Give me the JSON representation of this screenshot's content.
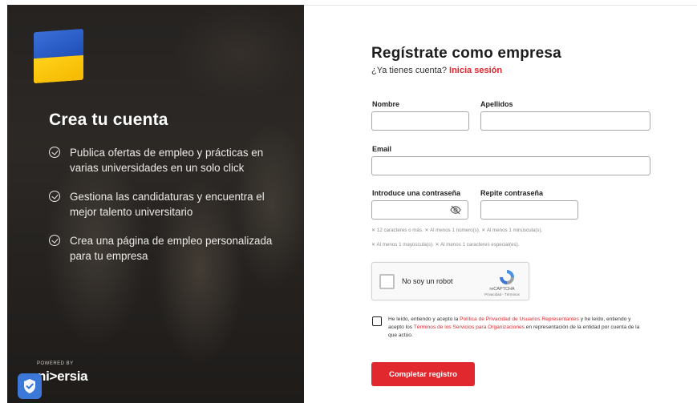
{
  "hero": {
    "title": "Crea tu cuenta",
    "benefits": [
      "Publica ofertas de empleo y prácticas en varias universidades en un solo click",
      "Gestiona las candidaturas y encuentra el mejor talento universitario",
      "Crea una página de empleo personalizada para tu empresa"
    ],
    "powered_by": "POWERED BY",
    "brand": "ni>ersia",
    "flag_colors": {
      "blue": "#2a5cc8",
      "yellow": "#ffd21a"
    }
  },
  "form": {
    "title": "Regístrate como empresa",
    "login_prompt": "¿Ya tienes cuenta?",
    "login_link": "Inicia sesión",
    "fields": {
      "first_name": {
        "label": "Nombre",
        "value": ""
      },
      "last_name": {
        "label": "Apellidos",
        "value": ""
      },
      "email": {
        "label": "Email",
        "value": ""
      },
      "password": {
        "label": "Introduce una contraseña",
        "value": ""
      },
      "password_repeat": {
        "label": "Repite contraseña",
        "value": ""
      }
    },
    "password_rules_line1": "✕ 12 caracteres o más.  ✕ Al menos 1 número(s).  ✕ Al menos 1 minúscula(s).",
    "password_rules_line2": "✕ Al menos 1 mayúscula(s).  ✕ Al menos 1 caracteres especial(es).",
    "captcha": {
      "label": "No soy un robot",
      "brand": "reCAPTCHA",
      "links": "Privacidad - Términos"
    },
    "terms": {
      "part1": "He leído, entiendo y acepto la ",
      "privacy_link": "Política de Privacidad de Usuarios Representantes",
      "part2": " y he leído, entiendo y acepto los ",
      "services_link": "Términos de los Servicios para Organizaciones",
      "part3": " en representación de la entidad por cuenta de la que actúo."
    },
    "submit_label": "Completar registro"
  },
  "colors": {
    "accent": "#e0282e",
    "badge": "#3c78d8"
  }
}
